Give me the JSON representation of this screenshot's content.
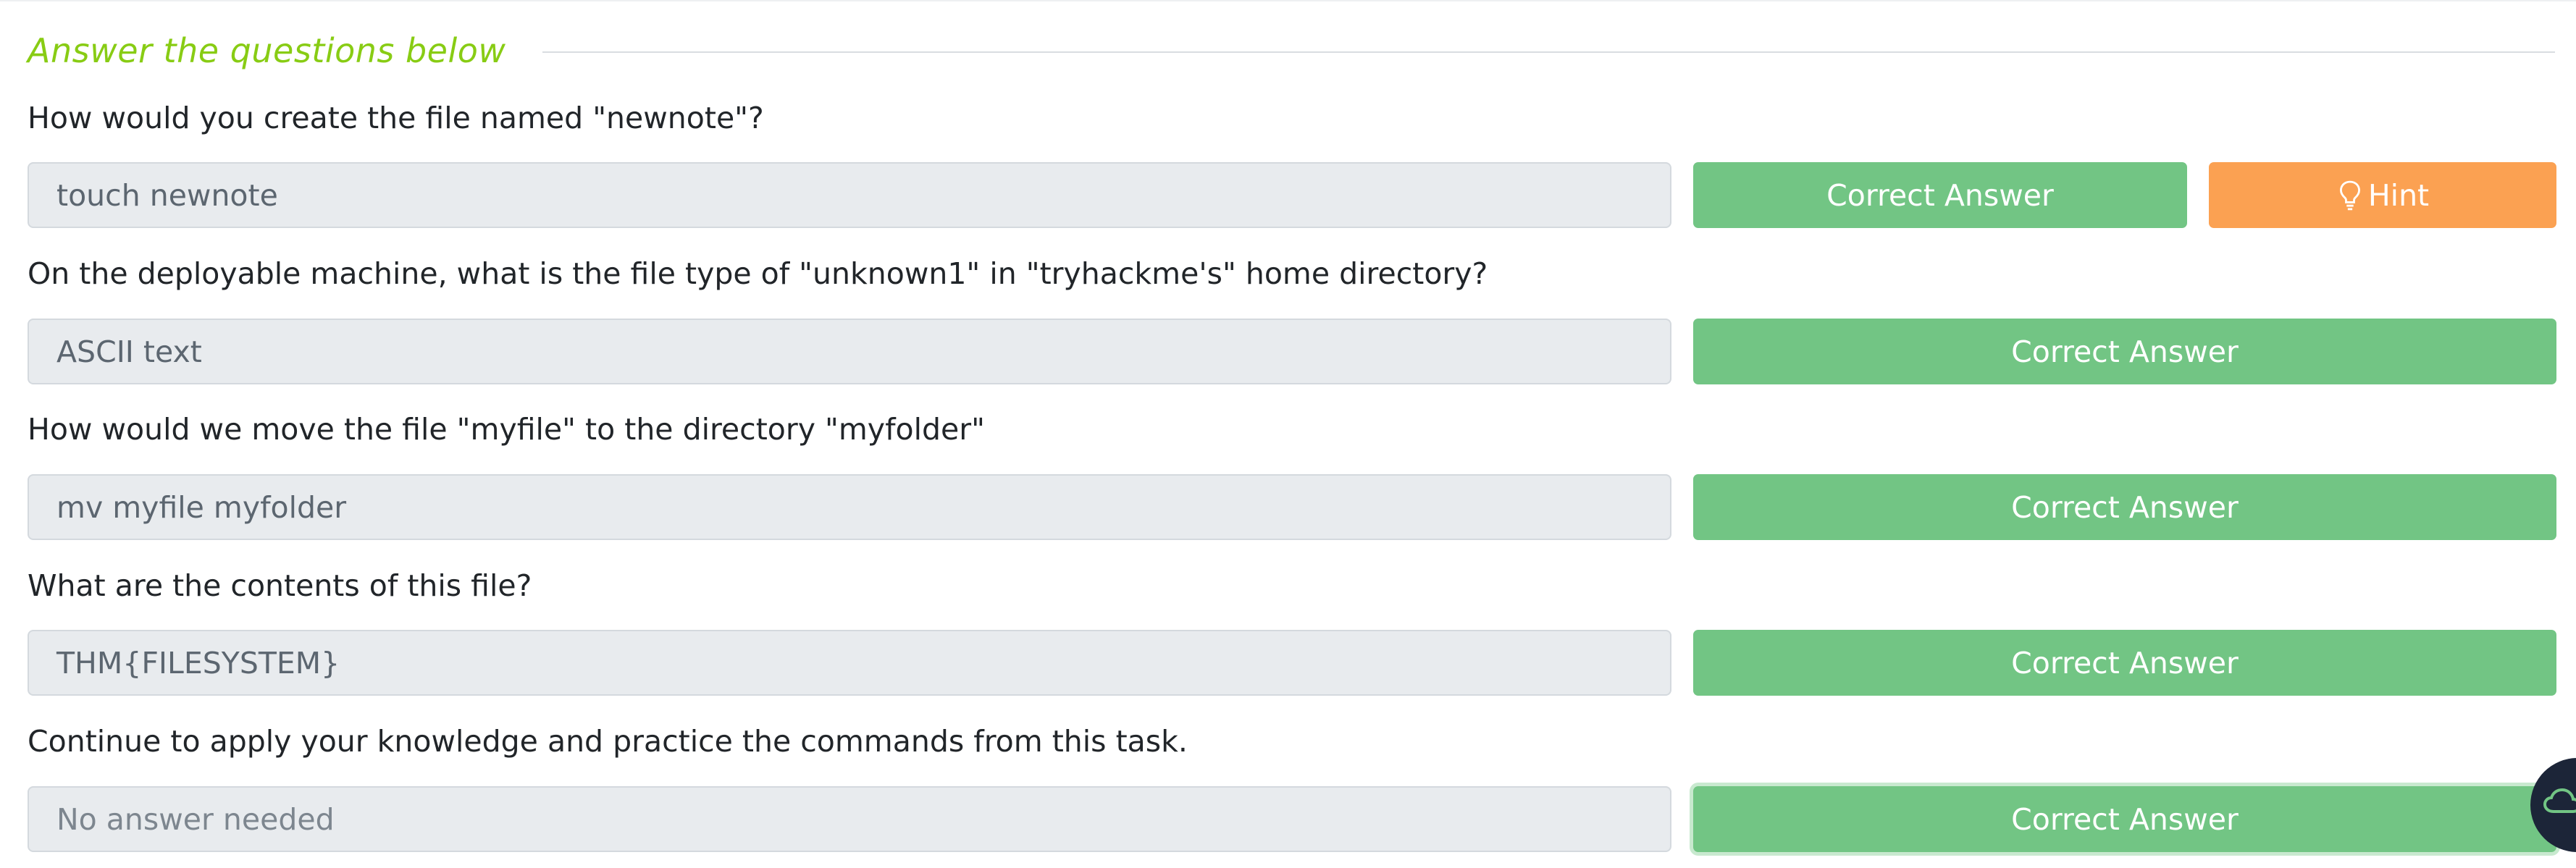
{
  "section": {
    "title": "Answer the questions below"
  },
  "questions": [
    {
      "text": "How would you create the file named \"newnote\"?",
      "answer": "touch newnote",
      "button_label": "Correct Answer",
      "hint_label": "Hint"
    },
    {
      "text": "On the deployable machine, what is the file type of \"unknown1\" in \"tryhackme's\" home directory?",
      "answer": "ASCII text",
      "button_label": "Correct Answer"
    },
    {
      "text": "How would we move the file \"myfile\" to the directory \"myfolder\"",
      "answer": "mv myfile myfolder",
      "button_label": "Correct Answer"
    },
    {
      "text": "What are the contents of this file?",
      "answer": "THM{FILESYSTEM}",
      "button_label": "Correct Answer"
    },
    {
      "text": "Continue to apply your knowledge and practice the commands from this task.",
      "answer": "No answer needed",
      "button_label": "Correct Answer"
    }
  ],
  "icons": {
    "hint": "lightbulb-icon",
    "chat": "chat-cloud-icon"
  },
  "colors": {
    "title_green": "#88cc14",
    "correct_green": "#72c584",
    "hint_orange": "#fba152",
    "answer_bg": "#e8ebee",
    "chat_bg": "#1c2538"
  }
}
